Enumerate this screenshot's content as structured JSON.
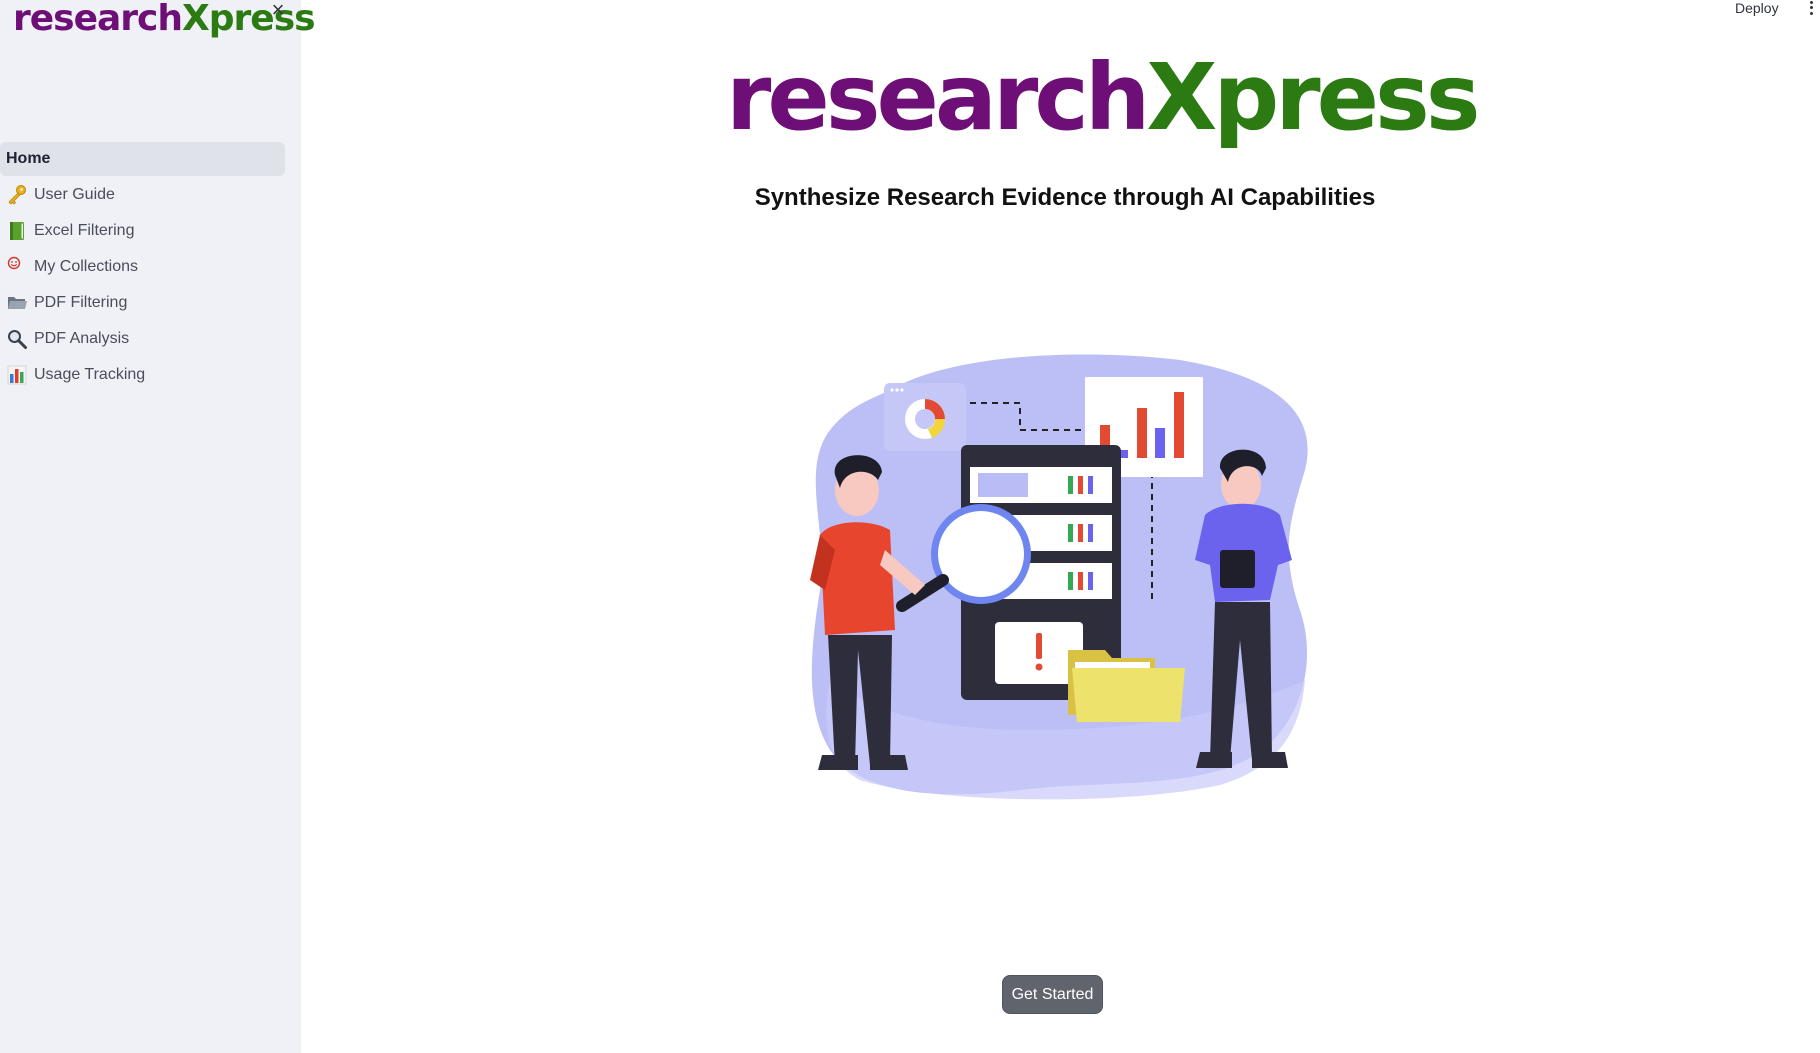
{
  "sidebar": {
    "logo_part1": "research",
    "logo_part2": "Xpress",
    "close_glyph": "×",
    "items": [
      {
        "label": "Home",
        "icon": "none",
        "active": true
      },
      {
        "label": "User Guide",
        "icon": "key-icon"
      },
      {
        "label": "Excel Filtering",
        "icon": "green-book-icon"
      },
      {
        "label": "My Collections",
        "icon": "smiley-icon"
      },
      {
        "label": "PDF Filtering",
        "icon": "folder-icon"
      },
      {
        "label": "PDF Analysis",
        "icon": "magnifier-icon"
      },
      {
        "label": "Usage Tracking",
        "icon": "bar-chart-icon"
      }
    ]
  },
  "header": {
    "deploy_label": "Deploy",
    "menu_icon": "kebab-menu-icon"
  },
  "main": {
    "title_part1": "research",
    "title_part2": "Xpress",
    "subtitle": "Synthesize Research Evidence through AI Capabilities",
    "cta_label": "Get Started"
  },
  "colors": {
    "brand_purple": "#6e0f78",
    "brand_green": "#2b7a12",
    "sidebar_bg": "#eff1f6",
    "button_bg": "#5f646d"
  }
}
